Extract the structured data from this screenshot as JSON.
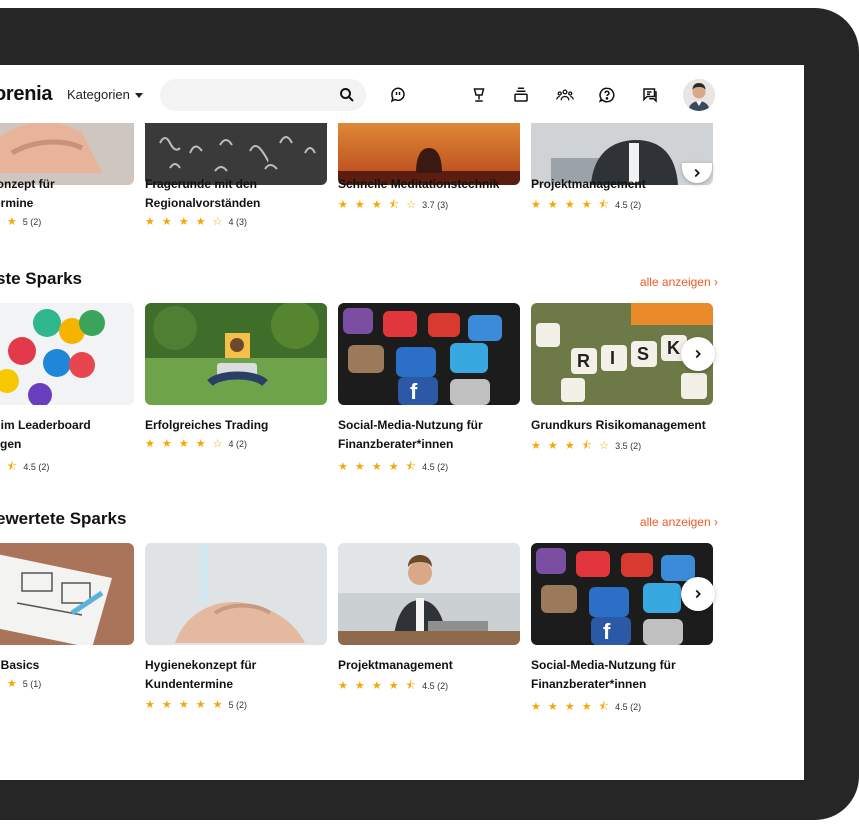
{
  "header": {
    "logo": "orenia",
    "categories_label": "Kategorien",
    "search_placeholder": ""
  },
  "top_row": [
    {
      "title": "konzept für termine",
      "title_lines": [
        "konzept für",
        "termine"
      ],
      "stars": "★ ★",
      "rating": "5 (2)"
    },
    {
      "title": "Fragerunde mit den Regionalvorständen",
      "title_lines": [
        "Fragerunde mit den",
        "Regionalvorständen"
      ],
      "stars": "★ ★ ★ ★ ☆",
      "rating": "4 (3)"
    },
    {
      "title": "Schnelle Meditationstechnik",
      "title_lines": [
        "Schnelle Meditationstechnik",
        ""
      ],
      "stars": "★ ★ ★ ⯪ ☆",
      "rating": "3.7 (3)"
    },
    {
      "title": "Projektmanagement",
      "title_lines": [
        "Projektmanagement",
        ""
      ],
      "stars": "★ ★ ★ ★ ⯪",
      "rating": "4.5 (2)"
    }
  ],
  "section1": {
    "title": "ste Sparks",
    "show_all": "alle anzeigen",
    "cards": [
      {
        "title_lines": [
          "n im Leaderboard",
          "eigen"
        ],
        "stars": "★ ⯪",
        "rating": "4.5 (2)"
      },
      {
        "title_lines": [
          "Erfolgreiches Trading",
          ""
        ],
        "stars": "★ ★ ★ ★ ☆",
        "rating": "4 (2)"
      },
      {
        "title_lines": [
          "Social-Media-Nutzung für",
          "Finanzberater*innen"
        ],
        "stars": "★ ★ ★ ★ ⯪",
        "rating": "4.5 (2)"
      },
      {
        "title_lines": [
          "Grundkurs Risikomanagement",
          ""
        ],
        "stars": "★ ★ ★ ⯪ ☆",
        "rating": "3.5 (2)"
      }
    ]
  },
  "section2": {
    "title": "ewertete Sparks",
    "show_all": "alle anzeigen",
    "cards": [
      {
        "title_lines": [
          "n Basics",
          ""
        ],
        "stars": "★ ★",
        "rating": "5 (1)"
      },
      {
        "title_lines": [
          "Hygienekonzept für",
          "Kundentermine"
        ],
        "stars": "★ ★ ★ ★ ★",
        "rating": "5 (2)"
      },
      {
        "title_lines": [
          "Projektmanagement",
          ""
        ],
        "stars": "★ ★ ★ ★ ⯪",
        "rating": "4.5 (2)"
      },
      {
        "title_lines": [
          "Social-Media-Nutzung für",
          "Finanzberater*innen"
        ],
        "stars": "★ ★ ★ ★ ⯪",
        "rating": "4.5 (2)"
      }
    ]
  },
  "colors": {
    "accent": "#f05a22",
    "star": "#f7a800",
    "bezel": "#262626"
  },
  "icons": [
    "search-icon",
    "lightbulb-chat-icon",
    "trophy-icon",
    "stack-icon",
    "team-icon",
    "help-icon",
    "messages-icon",
    "chevron-right-icon"
  ]
}
